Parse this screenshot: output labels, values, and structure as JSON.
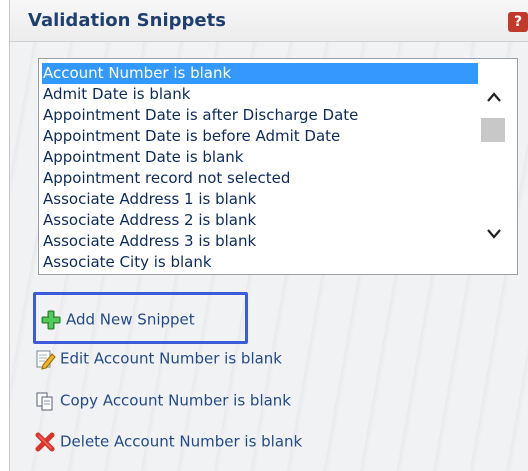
{
  "header": {
    "title": "Validation Snippets",
    "help_icon": "help-icon",
    "help_symbol": "?"
  },
  "snippets": {
    "items": [
      "Account Number is blank",
      "Admit Date is blank",
      "Appointment Date is after Discharge Date",
      "Appointment Date is before Admit Date",
      "Appointment Date is blank",
      "Appointment record not selected",
      "Associate Address 1 is blank",
      "Associate Address 2 is blank",
      "Associate Address 3 is blank",
      "Associate City is blank"
    ],
    "selected": "Account Number is blank",
    "scroll_up_symbol": "⌃",
    "scroll_down_symbol": "⌄"
  },
  "actions": {
    "add_label": "Add New Snippet",
    "edit_label": "Edit Account Number is blank",
    "copy_label": "Copy Account Number is blank",
    "delete_label": "Delete Account Number is blank"
  },
  "colors": {
    "title": "#1f3f6f",
    "selection": "#3399ff",
    "link": "#244b86",
    "highlight_border": "#3b5bdb",
    "add_icon": "#3cb043",
    "delete_icon": "#d9342b"
  }
}
